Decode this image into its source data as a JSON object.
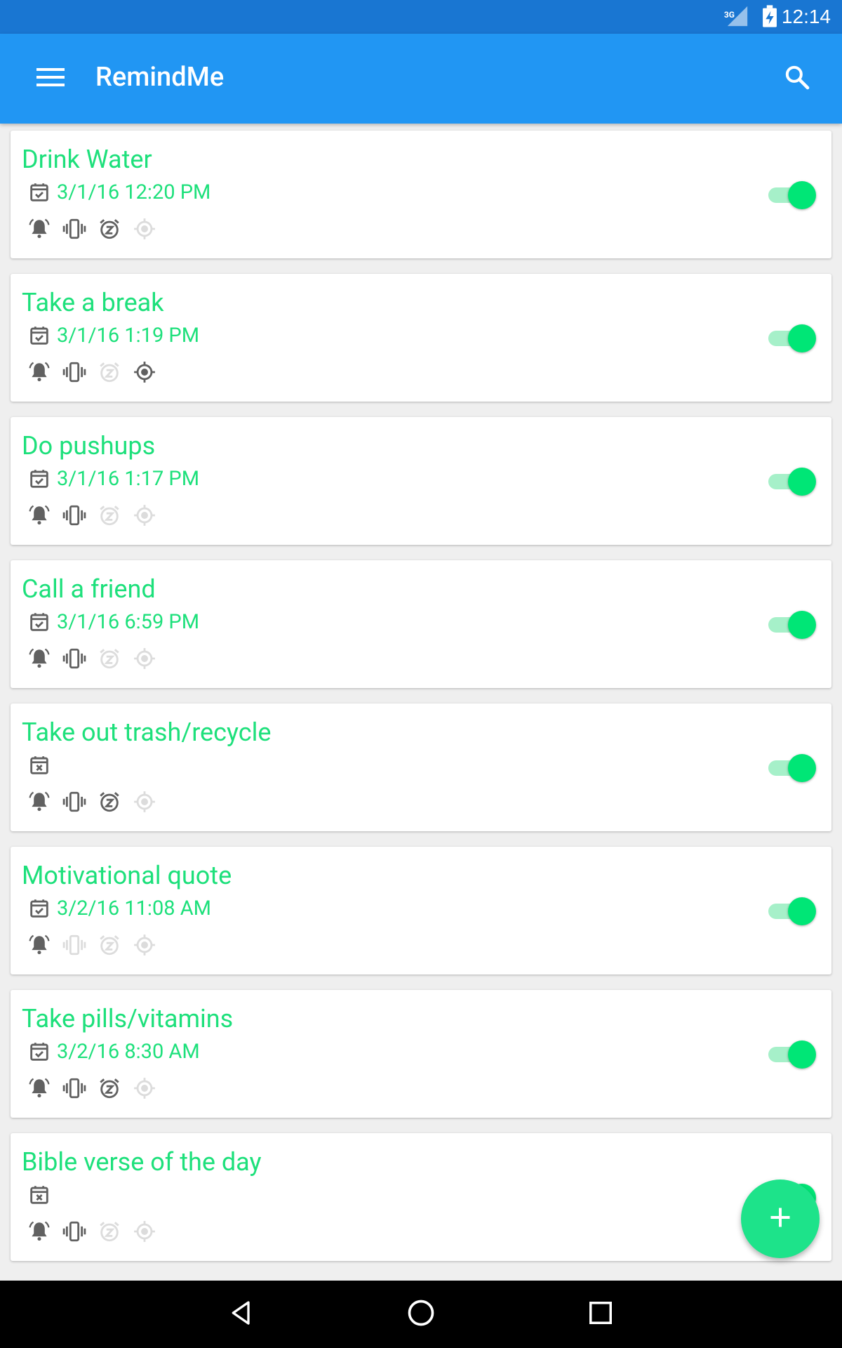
{
  "status_bar": {
    "network": "3G",
    "time": "12:14",
    "icons": [
      "signal-icon",
      "battery-charging-icon"
    ]
  },
  "app_bar": {
    "title": "RemindMe",
    "menu_icon": "menu-icon",
    "search_icon": "search-icon"
  },
  "colors": {
    "status_bar": "#1976d2",
    "app_bar": "#2196f3",
    "accent": "#1de07b",
    "icon_active": "#616161",
    "icon_inactive": "#dcdcdc"
  },
  "reminders": [
    {
      "title": "Drink Water",
      "date": "3/1/16 12:20 PM",
      "scheduled": true,
      "ringtone": true,
      "vibrate": true,
      "snooze": true,
      "location": false,
      "enabled": true
    },
    {
      "title": "Take a break",
      "date": "3/1/16 1:19 PM",
      "scheduled": true,
      "ringtone": true,
      "vibrate": true,
      "snooze": false,
      "location": true,
      "enabled": true
    },
    {
      "title": "Do pushups",
      "date": "3/1/16 1:17 PM",
      "scheduled": true,
      "ringtone": true,
      "vibrate": true,
      "snooze": false,
      "location": false,
      "enabled": true
    },
    {
      "title": "Call a friend",
      "date": "3/1/16 6:59 PM",
      "scheduled": true,
      "ringtone": true,
      "vibrate": true,
      "snooze": false,
      "location": false,
      "enabled": true
    },
    {
      "title": "Take out trash/recycle",
      "date": "",
      "scheduled": false,
      "ringtone": true,
      "vibrate": true,
      "snooze": true,
      "location": false,
      "enabled": true
    },
    {
      "title": "Motivational quote",
      "date": "3/2/16 11:08 AM",
      "scheduled": true,
      "ringtone": true,
      "vibrate": false,
      "snooze": false,
      "location": false,
      "enabled": true
    },
    {
      "title": "Take pills/vitamins",
      "date": "3/2/16 8:30 AM",
      "scheduled": true,
      "ringtone": true,
      "vibrate": true,
      "snooze": true,
      "location": false,
      "enabled": true
    },
    {
      "title": "Bible verse of the day",
      "date": "",
      "scheduled": false,
      "ringtone": true,
      "vibrate": true,
      "snooze": false,
      "location": false,
      "enabled": true
    }
  ],
  "fab": {
    "icon": "plus-icon"
  },
  "nav_bar": {
    "back_icon": "back-icon",
    "home_icon": "home-icon",
    "recents_icon": "recents-icon"
  }
}
